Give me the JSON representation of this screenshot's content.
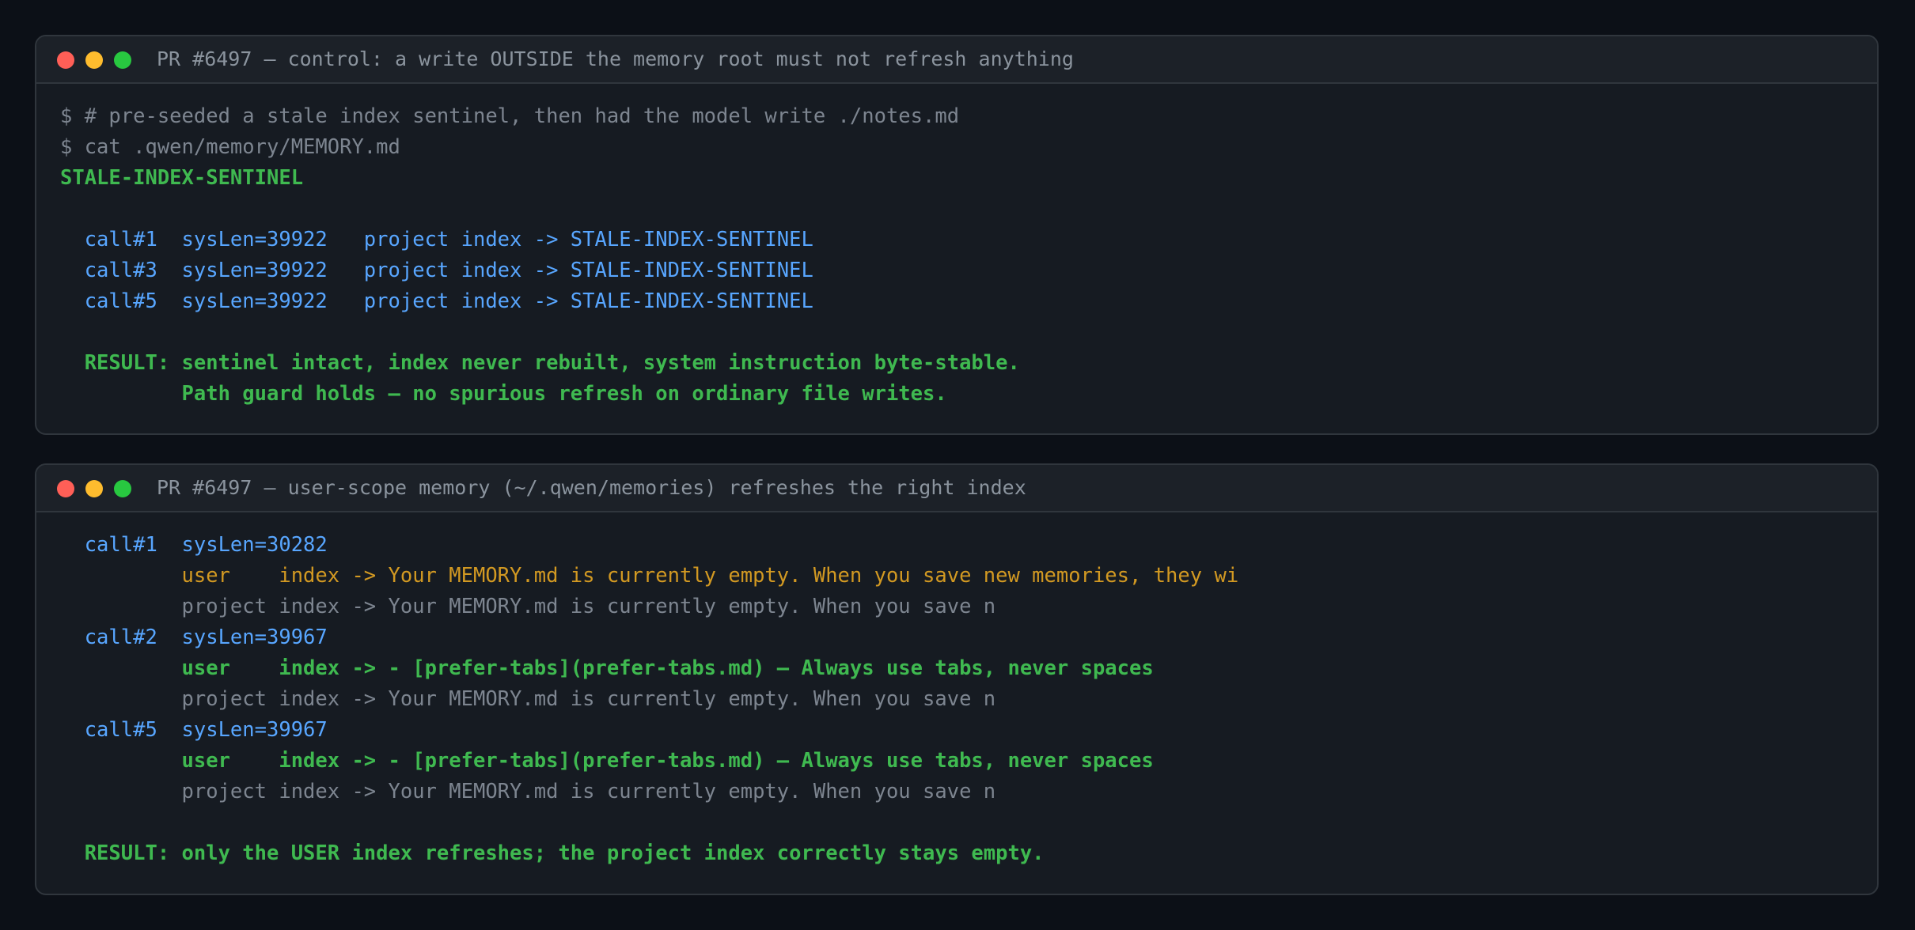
{
  "terminals": [
    {
      "title": "PR #6497 — control: a write OUTSIDE the memory root must not refresh anything",
      "lines": [
        {
          "text": "$ # pre-seeded a stale index sentinel, then had the model write ./notes.md",
          "style": "gray"
        },
        {
          "text": "$ cat .qwen/memory/MEMORY.md",
          "style": "gray"
        },
        {
          "text": "STALE-INDEX-SENTINEL",
          "style": "green"
        },
        {
          "text": "",
          "style": "gray"
        },
        {
          "text": "  call#1  sysLen=39922   project index -> STALE-INDEX-SENTINEL",
          "style": "blue"
        },
        {
          "text": "  call#3  sysLen=39922   project index -> STALE-INDEX-SENTINEL",
          "style": "blue"
        },
        {
          "text": "  call#5  sysLen=39922   project index -> STALE-INDEX-SENTINEL",
          "style": "blue"
        },
        {
          "text": "",
          "style": "gray"
        },
        {
          "text": "  RESULT: sentinel intact, index never rebuilt, system instruction byte-stable.",
          "style": "green"
        },
        {
          "text": "          Path guard holds — no spurious refresh on ordinary file writes.",
          "style": "green"
        }
      ]
    },
    {
      "title": "PR #6497 — user-scope memory (~/.qwen/memories) refreshes the right index",
      "lines": [
        {
          "text": "  call#1  sysLen=30282",
          "style": "blue"
        },
        {
          "text": "          user    index -> Your MEMORY.md is currently empty. When you save new memories, they wi",
          "style": "orange"
        },
        {
          "text": "          project index -> Your MEMORY.md is currently empty. When you save n",
          "style": "gray"
        },
        {
          "text": "  call#2  sysLen=39967",
          "style": "blue"
        },
        {
          "text": "          user    index -> - [prefer-tabs](prefer-tabs.md) — Always use tabs, never spaces",
          "style": "green"
        },
        {
          "text": "          project index -> Your MEMORY.md is currently empty. When you save n",
          "style": "gray"
        },
        {
          "text": "  call#5  sysLen=39967",
          "style": "blue"
        },
        {
          "text": "          user    index -> - [prefer-tabs](prefer-tabs.md) — Always use tabs, never spaces",
          "style": "green"
        },
        {
          "text": "          project index -> Your MEMORY.md is currently empty. When you save n",
          "style": "gray"
        },
        {
          "text": "",
          "style": "gray"
        },
        {
          "text": "  RESULT: only the USER index refreshes; the project index correctly stays empty.",
          "style": "green"
        }
      ]
    }
  ]
}
